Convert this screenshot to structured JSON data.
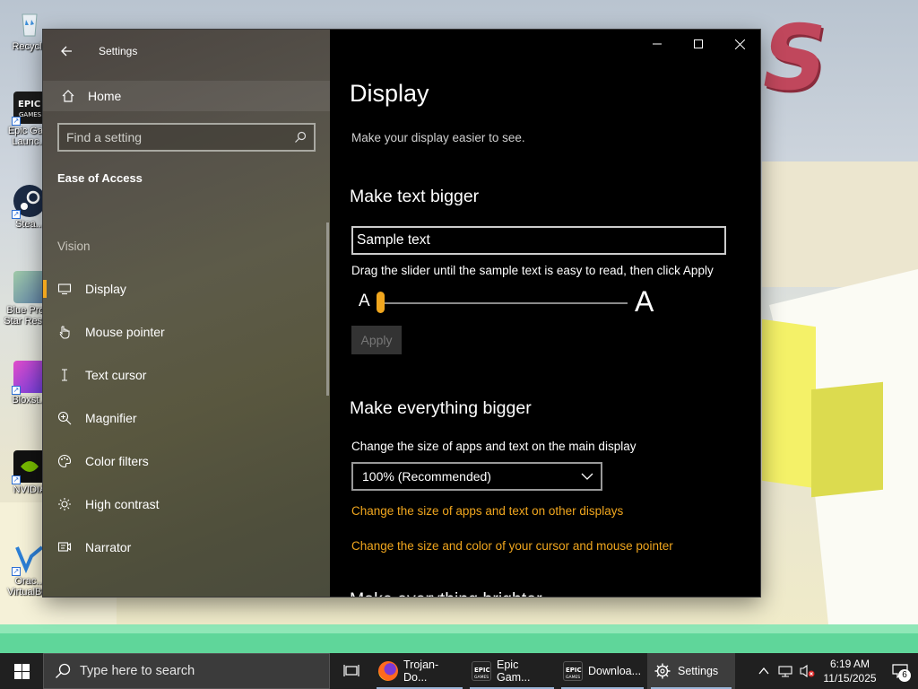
{
  "desktop": {
    "icons": [
      {
        "label": "Recycle",
        "icon": "recycle-bin-icon"
      },
      {
        "label": "Epic Ga... Launc...",
        "icon": "epic-games-icon"
      },
      {
        "label": "Stea...",
        "icon": "steam-icon"
      },
      {
        "label": "Blue Pro... Star Resc...",
        "icon": "game-icon"
      },
      {
        "label": "Bloxst...",
        "icon": "bloxstrap-icon"
      },
      {
        "label": "NVIDIA",
        "icon": "nvidia-icon"
      },
      {
        "label": "Orac... VirtualBox",
        "icon": "virtualbox-icon"
      }
    ],
    "wallpaper_letter": "S"
  },
  "window": {
    "title": "Settings",
    "home_label": "Home",
    "search_placeholder": "Find a setting",
    "category": "Ease of Access",
    "group_label": "Vision",
    "nav_items": [
      {
        "label": "Display",
        "icon": "monitor-icon",
        "active": true
      },
      {
        "label": "Mouse pointer",
        "icon": "mouse-pointer-icon",
        "active": false
      },
      {
        "label": "Text cursor",
        "icon": "text-cursor-icon",
        "active": false
      },
      {
        "label": "Magnifier",
        "icon": "magnifier-icon",
        "active": false
      },
      {
        "label": "Color filters",
        "icon": "color-filters-icon",
        "active": false
      },
      {
        "label": "High contrast",
        "icon": "high-contrast-icon",
        "active": false
      },
      {
        "label": "Narrator",
        "icon": "narrator-icon",
        "active": false
      }
    ]
  },
  "content": {
    "page_title": "Display",
    "page_subtitle": "Make your display easier to see.",
    "text_bigger_heading": "Make text bigger",
    "sample_text": "Sample text",
    "instruction": "Drag the slider until the sample text is easy to read, then click Apply",
    "slider_small": "A",
    "slider_large": "A",
    "slider_value": 0,
    "apply_label": "Apply",
    "everything_bigger_heading": "Make everything bigger",
    "change_size_label": "Change the size of apps and text on the main display",
    "scale_selected": "100% (Recommended)",
    "link_other_displays": "Change the size of apps and text on other displays",
    "link_cursor": "Change the size and color of your cursor and mouse pointer",
    "next_heading_cut": "Make everything brighter"
  },
  "taskbar": {
    "search_placeholder": "Type here to search",
    "apps": [
      {
        "label": "Trojan-Do...",
        "icon": "firefox-icon",
        "open": true,
        "active": false
      },
      {
        "label": "Epic Gam...",
        "icon": "epic-games-icon",
        "open": true,
        "active": false
      },
      {
        "label": "Downloa...",
        "icon": "epic-games-icon",
        "open": true,
        "active": false
      },
      {
        "label": "Settings",
        "icon": "gear-icon",
        "open": true,
        "active": true
      }
    ],
    "time": "6:19 AM",
    "date": "11/15/2025",
    "notification_count": "6"
  },
  "colors": {
    "accent": "#f0a61e",
    "content_bg": "#000000",
    "taskbar_bg": "#202020"
  }
}
